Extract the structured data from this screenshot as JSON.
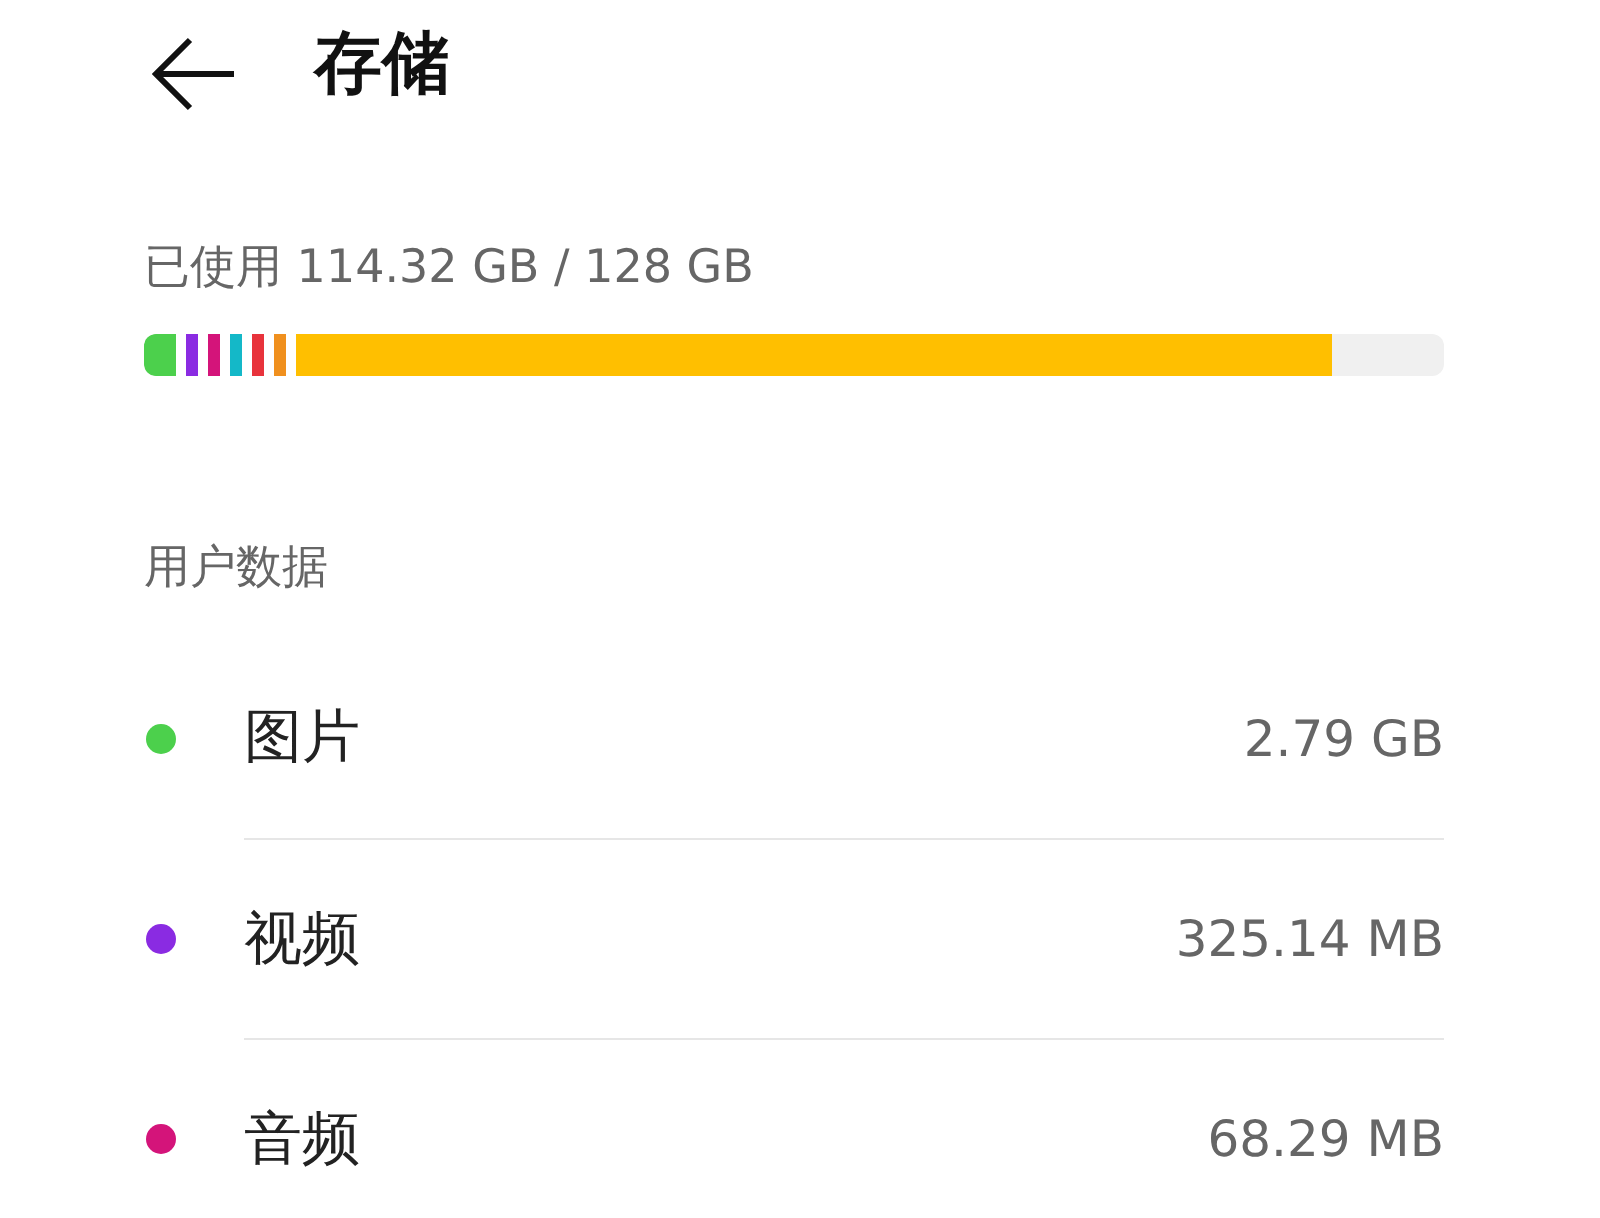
{
  "header": {
    "title": "存储"
  },
  "usage": {
    "summary": "已使用 114.32 GB / 128 GB",
    "level": 0.914,
    "segments": [
      {
        "color": "#4cd04c"
      },
      {
        "color": "#8a2be2"
      },
      {
        "color": "#d4147a"
      },
      {
        "color": "#14b8c8"
      },
      {
        "color": "#e8333c"
      },
      {
        "color": "#f0901e"
      },
      {
        "color": "#ffbf00"
      }
    ]
  },
  "section": {
    "title": "用户数据"
  },
  "items": [
    {
      "label": "图片",
      "size": "2.79 GB",
      "color": "#4cd04c"
    },
    {
      "label": "视频",
      "size": "325.14 MB",
      "color": "#8a2be2"
    },
    {
      "label": "音频",
      "size": "68.29 MB",
      "color": "#d4147a"
    }
  ]
}
